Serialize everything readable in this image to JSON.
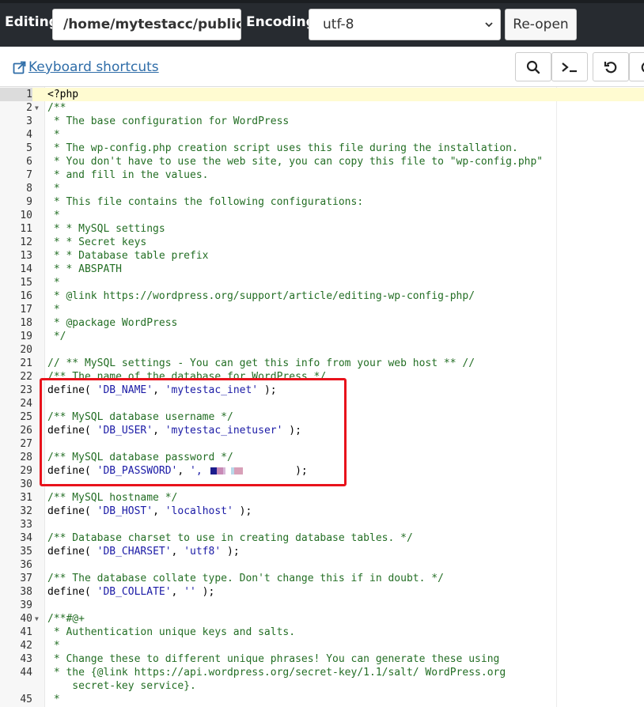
{
  "header": {
    "editing_label": "Editing:",
    "path_value": "/home/mytestacc/public_",
    "encoding_label": "Encoding:",
    "encoding_value": "utf-8",
    "reopen_label": "Re-open"
  },
  "toolbar": {
    "keyboard_shortcuts_label": "Keyboard shortcuts",
    "buttons": [
      {
        "name": "search",
        "icon": "search-icon"
      },
      {
        "name": "terminal",
        "icon": "terminal-icon"
      },
      {
        "name": "undo",
        "icon": "undo-icon"
      },
      {
        "name": "redo",
        "icon": "redo-icon"
      }
    ]
  },
  "editor": {
    "active_line": 1,
    "fold_lines": [
      2,
      40
    ],
    "lines": [
      {
        "n": "1",
        "t": [
          {
            "c": "p",
            "v": "<?php"
          }
        ]
      },
      {
        "n": "2",
        "t": [
          {
            "c": "c",
            "v": "/**"
          }
        ]
      },
      {
        "n": "3",
        "t": [
          {
            "c": "c",
            "v": " * The base configuration for WordPress"
          }
        ]
      },
      {
        "n": "4",
        "t": [
          {
            "c": "c",
            "v": " *"
          }
        ]
      },
      {
        "n": "5",
        "t": [
          {
            "c": "c",
            "v": " * The wp-config.php creation script uses this file during the installation."
          }
        ]
      },
      {
        "n": "6",
        "t": [
          {
            "c": "c",
            "v": " * You don't have to use the web site, you can copy this file to \"wp-config.php\""
          }
        ]
      },
      {
        "n": "7",
        "t": [
          {
            "c": "c",
            "v": " * and fill in the values."
          }
        ]
      },
      {
        "n": "8",
        "t": [
          {
            "c": "c",
            "v": " *"
          }
        ]
      },
      {
        "n": "9",
        "t": [
          {
            "c": "c",
            "v": " * This file contains the following configurations:"
          }
        ]
      },
      {
        "n": "10",
        "t": [
          {
            "c": "c",
            "v": " *"
          }
        ]
      },
      {
        "n": "11",
        "t": [
          {
            "c": "c",
            "v": " * * MySQL settings"
          }
        ]
      },
      {
        "n": "12",
        "t": [
          {
            "c": "c",
            "v": " * * Secret keys"
          }
        ]
      },
      {
        "n": "13",
        "t": [
          {
            "c": "c",
            "v": " * * Database table prefix"
          }
        ]
      },
      {
        "n": "14",
        "t": [
          {
            "c": "c",
            "v": " * * ABSPATH"
          }
        ]
      },
      {
        "n": "15",
        "t": [
          {
            "c": "c",
            "v": " *"
          }
        ]
      },
      {
        "n": "16",
        "t": [
          {
            "c": "c",
            "v": " * @link https://wordpress.org/support/article/editing-wp-config-php/"
          }
        ]
      },
      {
        "n": "17",
        "t": [
          {
            "c": "c",
            "v": " *"
          }
        ]
      },
      {
        "n": "18",
        "t": [
          {
            "c": "c",
            "v": " * @package WordPress"
          }
        ]
      },
      {
        "n": "19",
        "t": [
          {
            "c": "c",
            "v": " */"
          }
        ]
      },
      {
        "n": "20",
        "t": []
      },
      {
        "n": "21",
        "t": [
          {
            "c": "c",
            "v": "// ** MySQL settings - You can get this info from your web host ** //"
          }
        ]
      },
      {
        "n": "22",
        "t": [
          {
            "c": "c",
            "v": "/** The name of the database for WordPress */"
          }
        ]
      },
      {
        "n": "23",
        "t": [
          {
            "c": "p",
            "v": "define( "
          },
          {
            "c": "s",
            "v": "'DB_NAME'"
          },
          {
            "c": "p",
            "v": ", "
          },
          {
            "c": "s",
            "v": "'mytestac_inet'"
          },
          {
            "c": "p",
            "v": " );"
          }
        ]
      },
      {
        "n": "24",
        "t": []
      },
      {
        "n": "25",
        "t": [
          {
            "c": "c",
            "v": "/** MySQL database username */"
          }
        ]
      },
      {
        "n": "26",
        "t": [
          {
            "c": "p",
            "v": "define( "
          },
          {
            "c": "s",
            "v": "'DB_USER'"
          },
          {
            "c": "p",
            "v": ", "
          },
          {
            "c": "s",
            "v": "'mytestac_inetuser'"
          },
          {
            "c": "p",
            "v": " );"
          }
        ]
      },
      {
        "n": "27",
        "t": []
      },
      {
        "n": "28",
        "t": [
          {
            "c": "c",
            "v": "/** MySQL database password */"
          }
        ]
      },
      {
        "n": "29",
        "t": [
          {
            "c": "p",
            "v": "define( "
          },
          {
            "c": "s",
            "v": "'DB_PASSWORD'"
          },
          {
            "c": "p",
            "v": ", "
          },
          {
            "c": "s",
            "v": "',"
          },
          {
            "c": "p",
            "v": "               );"
          }
        ],
        "redacted": true
      },
      {
        "n": "30",
        "t": []
      },
      {
        "n": "31",
        "t": [
          {
            "c": "c",
            "v": "/** MySQL hostname */"
          }
        ]
      },
      {
        "n": "32",
        "t": [
          {
            "c": "p",
            "v": "define( "
          },
          {
            "c": "s",
            "v": "'DB_HOST'"
          },
          {
            "c": "p",
            "v": ", "
          },
          {
            "c": "s",
            "v": "'localhost'"
          },
          {
            "c": "p",
            "v": " );"
          }
        ]
      },
      {
        "n": "33",
        "t": []
      },
      {
        "n": "34",
        "t": [
          {
            "c": "c",
            "v": "/** Database charset to use in creating database tables. */"
          }
        ]
      },
      {
        "n": "35",
        "t": [
          {
            "c": "p",
            "v": "define( "
          },
          {
            "c": "s",
            "v": "'DB_CHARSET'"
          },
          {
            "c": "p",
            "v": ", "
          },
          {
            "c": "s",
            "v": "'utf8'"
          },
          {
            "c": "p",
            "v": " );"
          }
        ]
      },
      {
        "n": "36",
        "t": []
      },
      {
        "n": "37",
        "t": [
          {
            "c": "c",
            "v": "/** The database collate type. Don't change this if in doubt. */"
          }
        ]
      },
      {
        "n": "38",
        "t": [
          {
            "c": "p",
            "v": "define( "
          },
          {
            "c": "s",
            "v": "'DB_COLLATE'"
          },
          {
            "c": "p",
            "v": ", "
          },
          {
            "c": "s",
            "v": "''"
          },
          {
            "c": "p",
            "v": " );"
          }
        ]
      },
      {
        "n": "39",
        "t": []
      },
      {
        "n": "40",
        "t": [
          {
            "c": "c",
            "v": "/**#@+"
          }
        ]
      },
      {
        "n": "41",
        "t": [
          {
            "c": "c",
            "v": " * Authentication unique keys and salts."
          }
        ]
      },
      {
        "n": "42",
        "t": [
          {
            "c": "c",
            "v": " *"
          }
        ]
      },
      {
        "n": "43",
        "t": [
          {
            "c": "c",
            "v": " * Change these to different unique phrases! You can generate these using"
          }
        ]
      },
      {
        "n": "44",
        "t": [
          {
            "c": "c",
            "v": " * the {@link https://api.wordpress.org/secret-key/1.1/salt/ WordPress.org"
          }
        ]
      },
      {
        "n": "",
        "t": [
          {
            "c": "c",
            "v": "    secret-key service}."
          }
        ]
      },
      {
        "n": "45",
        "t": [
          {
            "c": "c",
            "v": " *"
          }
        ]
      }
    ]
  },
  "colors": {
    "topbar": "#272b30",
    "link": "#2f6da8",
    "comment": "#236e24",
    "string": "#1a1aa6",
    "highlight_box": "#e8121b"
  }
}
